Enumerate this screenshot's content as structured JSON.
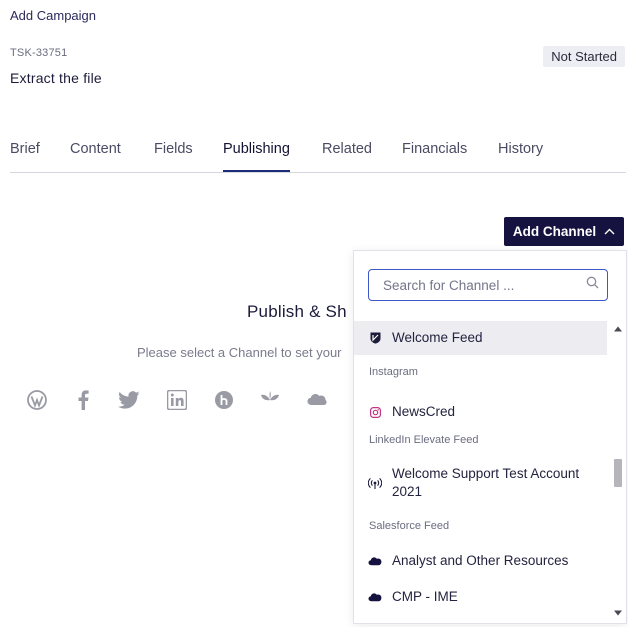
{
  "breadcrumb": "Add Campaign",
  "task": {
    "id": "TSK-33751",
    "title": "Extract the file",
    "status": "Not Started"
  },
  "tabs": [
    {
      "label": "Brief"
    },
    {
      "label": "Content"
    },
    {
      "label": "Fields"
    },
    {
      "label": "Publishing",
      "active": true
    },
    {
      "label": "Related"
    },
    {
      "label": "Financials"
    },
    {
      "label": "History"
    }
  ],
  "add_channel": {
    "label": "Add Channel",
    "icon": "chevron-up-icon"
  },
  "publish": {
    "title": "Publish & Sh",
    "subtitle": "Please select a Channel to set your"
  },
  "social_icons": [
    "wordpress-icon",
    "facebook-icon",
    "twitter-icon",
    "linkedin-icon",
    "hootsuite-icon",
    "sprout-icon",
    "salesforce-icon"
  ],
  "dropdown": {
    "search_placeholder": "Search for Channel ...",
    "items": [
      {
        "kind": "item",
        "label": "Welcome Feed",
        "icon": "shield-icon",
        "selected": true
      },
      {
        "kind": "group",
        "label": "Instagram"
      },
      {
        "kind": "item",
        "label": "NewsCred",
        "icon": "instagram-icon"
      },
      {
        "kind": "group",
        "label": "LinkedIn Elevate Feed"
      },
      {
        "kind": "item",
        "label": "Welcome Support Test Account 2021",
        "icon": "broadcast-icon"
      },
      {
        "kind": "group",
        "label": "Salesforce Feed"
      },
      {
        "kind": "item",
        "label": "Analyst and Other Resources",
        "icon": "cloud-icon"
      },
      {
        "kind": "item",
        "label": "CMP - IME",
        "icon": "cloud-icon"
      }
    ]
  },
  "colors": {
    "primary": "#15123f",
    "accent": "#1d2c78",
    "focus": "#3e57c8",
    "instagram": "#c13584"
  }
}
